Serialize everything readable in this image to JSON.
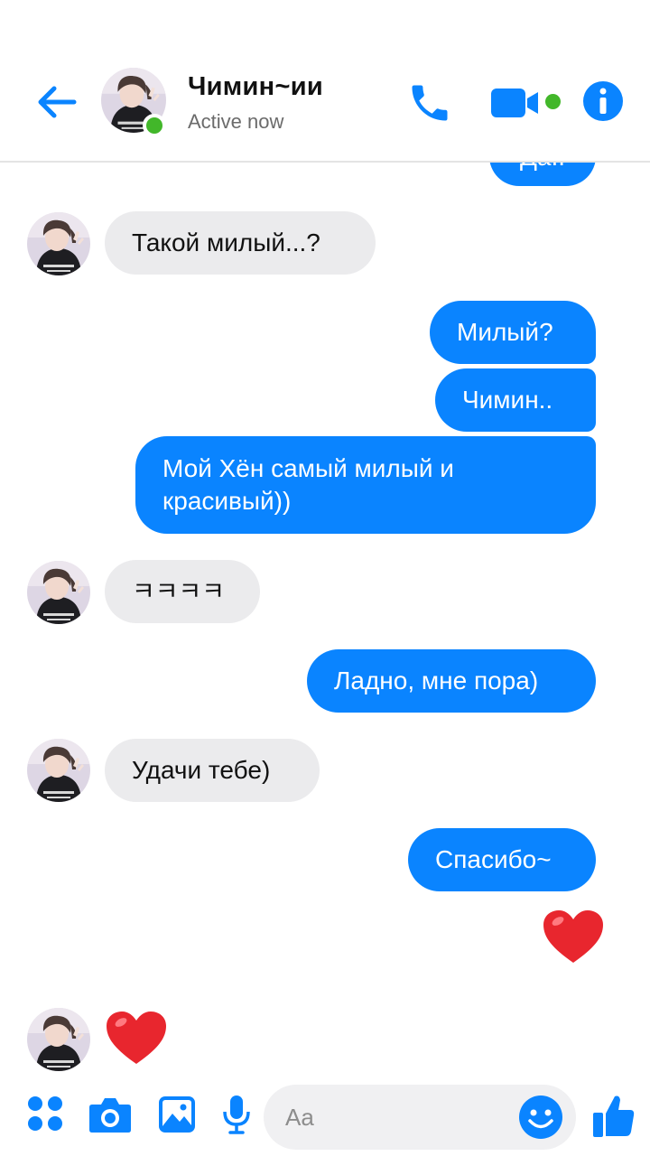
{
  "header": {
    "contact_name": "Чимин~ии",
    "status": "Active now",
    "icons": [
      "back-arrow-icon",
      "phone-icon",
      "video-camera-icon",
      "info-icon"
    ]
  },
  "messages": {
    "partial_top": "Да..",
    "m1": "Такой милый...?",
    "m2": "Милый?",
    "m3": "Чимин..",
    "m4": "Мой Хён самый милый и\nкрасивый))",
    "m5": "ㅋㅋㅋㅋ",
    "m6": "Ладно, мне пора)",
    "m7": "Удачи тебе)",
    "m8": "Спасибо~",
    "reaction_out": "heart",
    "reaction_in": "heart"
  },
  "composer": {
    "placeholder": "Aa",
    "icons": [
      "apps-grid-icon",
      "camera-icon",
      "gallery-icon",
      "microphone-icon",
      "emoji-icon",
      "thumbs-up-icon"
    ]
  },
  "colors": {
    "accent": "#0a84ff",
    "incoming_bubble": "#ebebed",
    "online": "#42b72a",
    "heart": "#e8262e"
  }
}
